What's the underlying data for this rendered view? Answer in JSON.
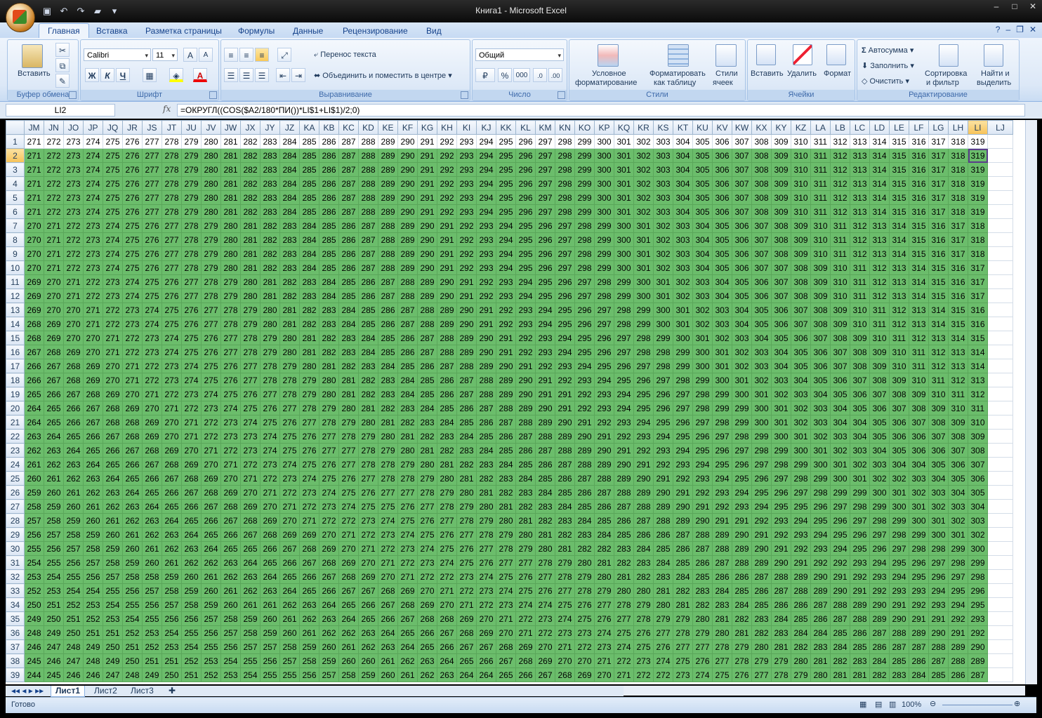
{
  "window": {
    "title": "Книга1 - Microsoft Excel"
  },
  "tabs": [
    "Главная",
    "Вставка",
    "Разметка страницы",
    "Формулы",
    "Данные",
    "Рецензирование",
    "Вид"
  ],
  "ribbon": {
    "clipboard": {
      "title": "Буфер обмена",
      "paste": "Вставить"
    },
    "font": {
      "title": "Шрифт",
      "name": "Calibri",
      "size": "11",
      "bold": "Ж",
      "italic": "К",
      "underline": "Ч"
    },
    "alignment": {
      "title": "Выравнивание",
      "wrap": "Перенос текста",
      "merge": "Объединить и поместить в центре"
    },
    "number": {
      "title": "Число",
      "format": "Общий",
      "percent": "%",
      "thousands": "000"
    },
    "styles": {
      "title": "Стили",
      "cond1": "Условное",
      "cond2": "форматирование",
      "table1": "Форматировать",
      "table2": "как таблицу",
      "cell1": "Стили",
      "cell2": "ячеек"
    },
    "cells": {
      "title": "Ячейки",
      "insert": "Вставить",
      "delete": "Удалить",
      "format": "Формат"
    },
    "editing": {
      "title": "Редактирование",
      "autosum": "Автосумма",
      "fill": "Заполнить",
      "clear": "Очистить",
      "sort1": "Сортировка",
      "sort2": "и фильтр",
      "find1": "Найти и",
      "find2": "выделить"
    }
  },
  "formula_bar": {
    "name_box": "LI2",
    "fx": "fx",
    "formula": "=ОКРУГЛ((COS($A2/180*ПИ())*LI$1+LI$1)/2;0)"
  },
  "grid": {
    "columns": [
      "JM",
      "JN",
      "JO",
      "JP",
      "JQ",
      "JR",
      "JS",
      "JT",
      "JU",
      "JV",
      "JW",
      "JX",
      "JY",
      "JZ",
      "KA",
      "KB",
      "KC",
      "KD",
      "KE",
      "KF",
      "KG",
      "KH",
      "KI",
      "KJ",
      "KK",
      "KL",
      "KM",
      "KN",
      "KO",
      "KP",
      "KQ",
      "KR",
      "KS",
      "KT",
      "KU",
      "KV",
      "KW",
      "KX",
      "KY",
      "KZ",
      "LA",
      "LB",
      "LC",
      "LD",
      "LE",
      "LF",
      "LG",
      "LH",
      "LI",
      "LJ"
    ],
    "first_row": 1,
    "last_row": 39,
    "first_value": 271,
    "selected_cell": "LI2"
  },
  "sheets": [
    "Лист1",
    "Лист2",
    "Лист3"
  ],
  "status": {
    "ready": "Готово",
    "zoom": "100%"
  },
  "colors": {
    "cell_fill": "#6bbd6b",
    "selected_header": "#f7c257"
  }
}
